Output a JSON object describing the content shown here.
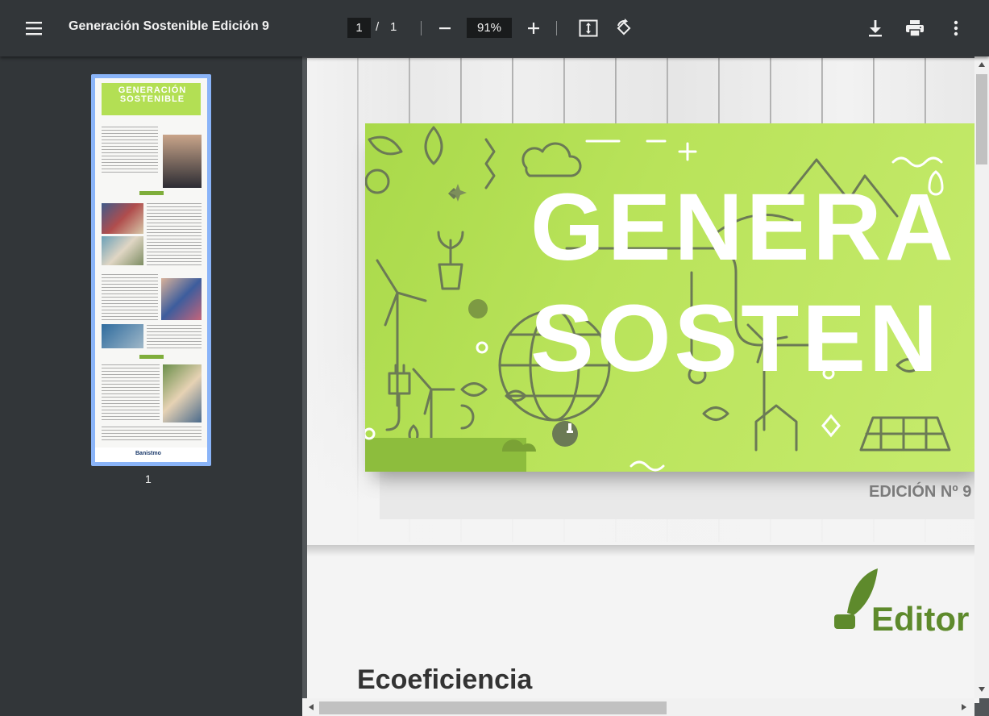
{
  "toolbar": {
    "title": "Generación Sostenible Edición 9",
    "current_page": "1",
    "page_separator": "/",
    "total_pages": "1",
    "zoom": "91%",
    "icons": [
      "menu-icon",
      "zoom-out-icon",
      "zoom-in-icon",
      "fit-page-icon",
      "rotate-icon",
      "download-icon",
      "print-icon",
      "more-icon"
    ]
  },
  "sidebar": {
    "thumbnail_number": "1",
    "thumbnail_title": "GENERACIÓN SOSTENIBLE",
    "thumbnail_footer": "Banistmo"
  },
  "document": {
    "banner_title_line1": "GENERA",
    "banner_title_line2": "SOSTEN",
    "edition": "EDICIÓN Nº 9",
    "section_heading": "Editor",
    "article_heading": "Ecoeficiencia"
  },
  "colors": {
    "toolbar_bg": "#323639",
    "viewer_bg": "#525659",
    "banner_green": "#b9e35a",
    "editorial_green": "#5e8a2c",
    "thumbnail_highlight": "#8ab4f8"
  }
}
